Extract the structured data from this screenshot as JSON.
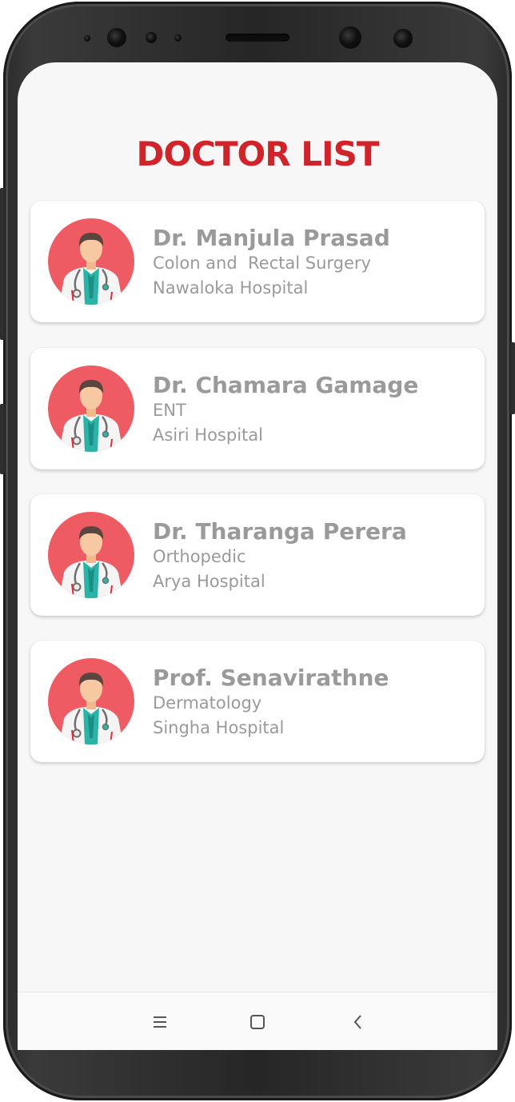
{
  "screen": {
    "title": "DOCTOR LIST"
  },
  "doctors": [
    {
      "name": "Dr. Manjula Prasad",
      "specialty": "Colon and  Rectal Surgery",
      "hospital": "Nawaloka Hospital",
      "avatar_icon": "doctor-avatar-icon"
    },
    {
      "name": "Dr. Chamara Gamage",
      "specialty": "ENT",
      "hospital": "Asiri Hospital",
      "avatar_icon": "doctor-avatar-icon"
    },
    {
      "name": "Dr. Tharanga Perera",
      "specialty": "Orthopedic",
      "hospital": "Arya Hospital",
      "avatar_icon": "doctor-avatar-icon"
    },
    {
      "name": "Prof. Senavirathne",
      "specialty": "Dermatology",
      "hospital": "Singha Hospital",
      "avatar_icon": "doctor-avatar-icon"
    }
  ],
  "navbar": {
    "icons": [
      "recent-apps-icon",
      "home-icon",
      "back-icon"
    ]
  },
  "colors": {
    "title": "#d1232a",
    "avatar_bg": "#ef5b63",
    "text_gray": "#9a9a9a",
    "screen_bg": "#f7f7f7"
  }
}
